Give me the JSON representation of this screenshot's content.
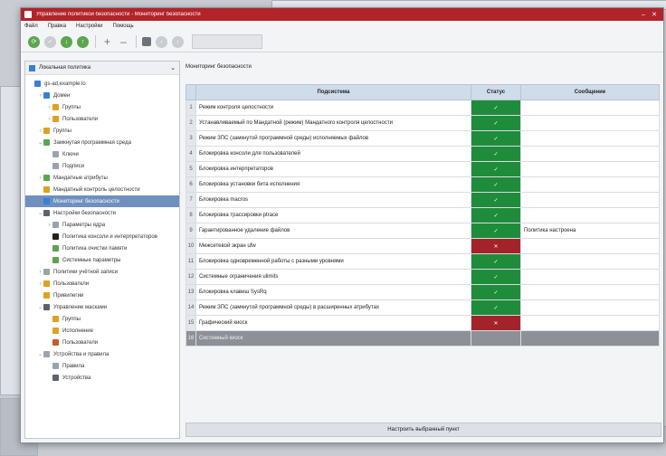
{
  "window": {
    "title": "Управление политикой безопасности - Мониторинг безопасности",
    "controls": [
      "–",
      "✕"
    ]
  },
  "menu": [
    "Файл",
    "Правка",
    "Настройки",
    "Помощь"
  ],
  "toolbar": {
    "round_buttons": [
      {
        "icon": "refresh-icon",
        "color": "#5ba54e"
      },
      {
        "icon": "apply-icon",
        "color": "#c9ccd1"
      },
      {
        "icon": "save-icon",
        "color": "#5ba54e"
      },
      {
        "icon": "load-icon",
        "color": "#5ba54e"
      }
    ],
    "plus": "+",
    "minus": "–"
  },
  "tree": {
    "header": "Локальная политика",
    "items": [
      {
        "label": "gs-ad.example.lo",
        "indent": 0,
        "arrow": "",
        "color": "#3a7fd5"
      },
      {
        "label": "Домен",
        "indent": 1,
        "arrow": "›",
        "color": "#3a7fd5"
      },
      {
        "label": "Группы",
        "indent": 2,
        "arrow": "›",
        "color": "#e0a020"
      },
      {
        "label": "Пользователи",
        "indent": 2,
        "arrow": "›",
        "color": "#e0a020"
      },
      {
        "label": "Группы",
        "indent": 1,
        "arrow": "›",
        "color": "#e0a020"
      },
      {
        "label": "Замкнутая программная среда",
        "indent": 1,
        "arrow": "⌄",
        "color": "#5ba54e"
      },
      {
        "label": "Ключи",
        "indent": 2,
        "arrow": "",
        "color": "#9aa3ad"
      },
      {
        "label": "Подписи",
        "indent": 2,
        "arrow": "",
        "color": "#9aa3ad"
      },
      {
        "label": "Мандатные атрибуты",
        "indent": 1,
        "arrow": "›",
        "color": "#5ba54e"
      },
      {
        "label": "Мандатный контроль целостности",
        "indent": 1,
        "arrow": "",
        "color": "#e0a020"
      },
      {
        "label": "Мониторинг безопасности",
        "indent": 1,
        "arrow": "",
        "color": "#3a7fd5",
        "selected": true
      },
      {
        "label": "Настройки безопасности",
        "indent": 1,
        "arrow": "⌄",
        "color": "#5a6170"
      },
      {
        "label": "Параметры ядра",
        "indent": 2,
        "arrow": "›",
        "color": "#9aa3ad"
      },
      {
        "label": "Политика консоли и интерпретаторов",
        "indent": 2,
        "arrow": "",
        "color": "#222"
      },
      {
        "label": "Политика очистки памяти",
        "indent": 2,
        "arrow": "",
        "color": "#5ba54e"
      },
      {
        "label": "Системные параметры",
        "indent": 2,
        "arrow": "",
        "color": "#5ba54e"
      },
      {
        "label": "Политики учётной записи",
        "indent": 1,
        "arrow": "›",
        "color": "#9aa3ad"
      },
      {
        "label": "Пользователи",
        "indent": 1,
        "arrow": "›",
        "color": "#e0a020"
      },
      {
        "label": "Привилегии",
        "indent": 1,
        "arrow": "",
        "color": "#e0a020"
      },
      {
        "label": "Управление масками",
        "indent": 1,
        "arrow": "⌄",
        "color": "#5a6170"
      },
      {
        "label": "Группы",
        "indent": 2,
        "arrow": "",
        "color": "#e0a020"
      },
      {
        "label": "Исполнение",
        "indent": 2,
        "arrow": "",
        "color": "#e0a020"
      },
      {
        "label": "Пользователи",
        "indent": 2,
        "arrow": "",
        "color": "#c75a28"
      },
      {
        "label": "Устройства и правила",
        "indent": 1,
        "arrow": "⌄",
        "color": "#9aa3ad"
      },
      {
        "label": "Правила",
        "indent": 2,
        "arrow": "",
        "color": "#9aa3ad"
      },
      {
        "label": "Устройства",
        "indent": 2,
        "arrow": "",
        "color": "#5a6170"
      }
    ]
  },
  "content": {
    "title": "Мониторинг безопасности",
    "columns": [
      "Подсистема",
      "Статус",
      "Сообщение"
    ],
    "rows": [
      {
        "n": "1",
        "name": "Режим контроля целостности",
        "status": "ok",
        "mark": "✓",
        "message": ""
      },
      {
        "n": "2",
        "name": "Устанавливаемый по Мандатной (режим) Мандатного контроля целостности",
        "status": "ok",
        "mark": "✓",
        "message": ""
      },
      {
        "n": "3",
        "name": "Режим ЗПС (замкнутой программной среды) исполняемых файлов",
        "status": "ok",
        "mark": "✓",
        "message": ""
      },
      {
        "n": "4",
        "name": "Блокировка консоли для пользователей",
        "status": "ok",
        "mark": "✓",
        "message": ""
      },
      {
        "n": "5",
        "name": "Блокировка интерпретаторов",
        "status": "ok",
        "mark": "✓",
        "message": ""
      },
      {
        "n": "6",
        "name": "Блокировка установки бита исполнения",
        "status": "ok",
        "mark": "✓",
        "message": ""
      },
      {
        "n": "7",
        "name": "Блокировка macros",
        "status": "ok",
        "mark": "✓",
        "message": ""
      },
      {
        "n": "8",
        "name": "Блокировка трассировки ptrace",
        "status": "ok",
        "mark": "✓",
        "message": ""
      },
      {
        "n": "9",
        "name": "Гарантированное удаление файлов",
        "status": "ok",
        "mark": "✓",
        "message": "Политика настроена"
      },
      {
        "n": "10",
        "name": "Межсетевой экран ufw",
        "status": "bad",
        "mark": "✕",
        "message": ""
      },
      {
        "n": "11",
        "name": "Блокировка одновременной работы с разными уровнями",
        "status": "ok",
        "mark": "✓",
        "message": ""
      },
      {
        "n": "12",
        "name": "Системные ограничения ulimits",
        "status": "ok",
        "mark": "✓",
        "message": ""
      },
      {
        "n": "13",
        "name": "Блокировка клавиш SysRq",
        "status": "ok",
        "mark": "✓",
        "message": ""
      },
      {
        "n": "14",
        "name": "Режим ЗПС (замкнутой программной среды) в расширенных атрибутах",
        "status": "ok",
        "mark": "✓",
        "message": ""
      },
      {
        "n": "15",
        "name": "Графический киоск",
        "status": "bad",
        "mark": "✕",
        "message": ""
      },
      {
        "n": "16",
        "name": "Системный киоск",
        "status": "sel",
        "mark": "",
        "message": "",
        "selected": true
      }
    ],
    "footer_button": "Настроить выбранный пункт"
  },
  "colors": {
    "ok": "#1f8c3b",
    "bad": "#a3232a",
    "title_bar": "#b3232a",
    "selection": "#6f8fbf"
  }
}
